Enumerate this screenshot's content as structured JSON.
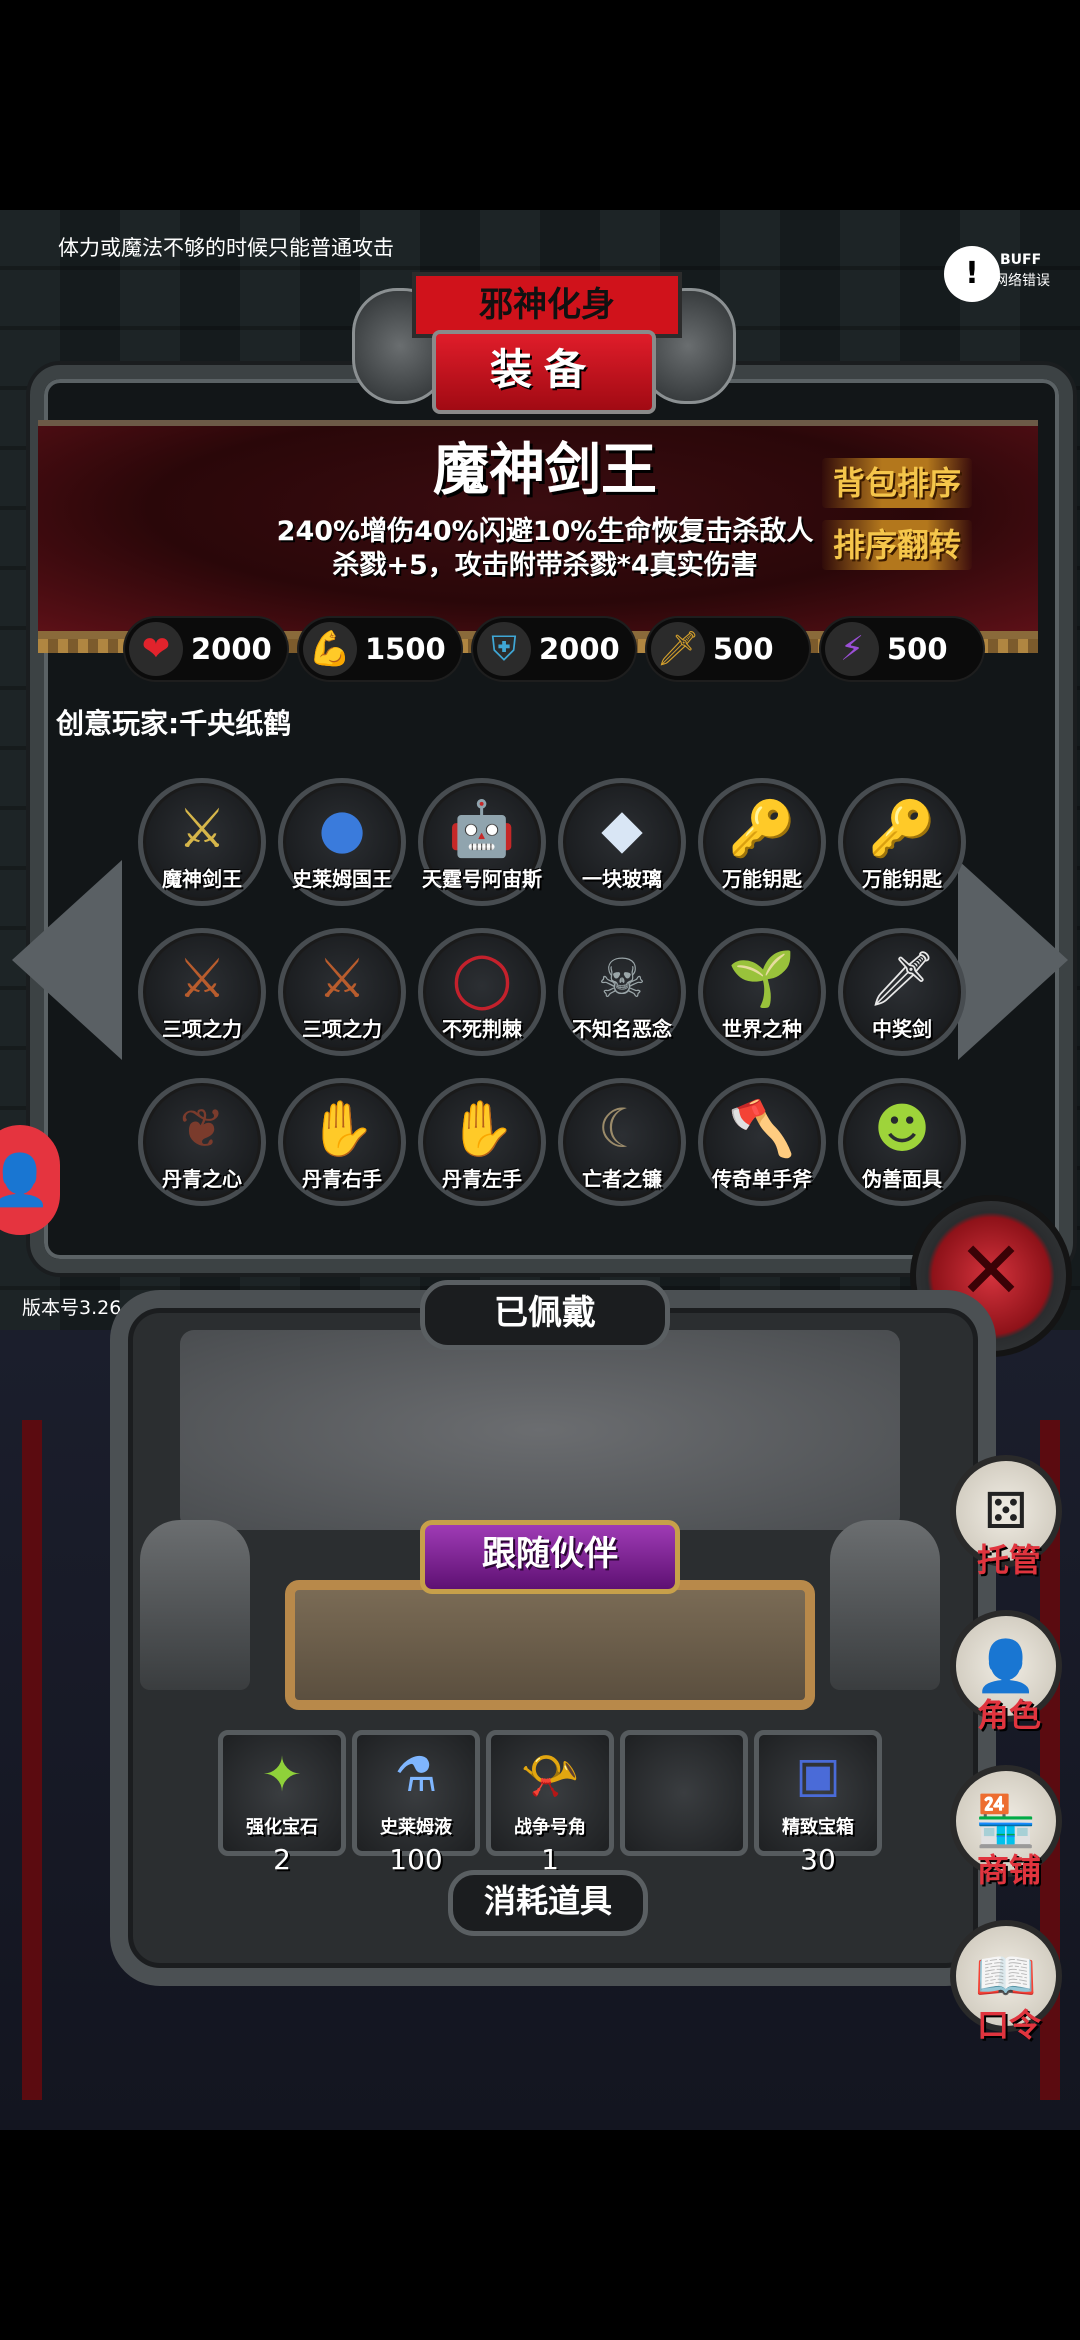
{
  "hint": "体力或魔法不够的时候只能普通攻击",
  "buff": {
    "icon": "buff-error-icon",
    "label": "BUFF",
    "status": "网络错误"
  },
  "header": {
    "subtitle": "邪神化身",
    "title": "装备"
  },
  "item": {
    "name": "魔神剑王",
    "desc_line1": "240%增伤40%闪避10%生命恢复击杀敌人",
    "desc_line2": "杀戮+5，攻击附带杀戮*4真实伤害"
  },
  "buttons": {
    "sort_bag": "背包排序",
    "sort_flip": "排序翻转"
  },
  "stats": [
    {
      "icon": "heart-icon",
      "glyph": "❤",
      "color": "#e2232c",
      "value": "2000"
    },
    {
      "icon": "strength-icon",
      "glyph": "💪",
      "color": "#e6c23a",
      "value": "1500"
    },
    {
      "icon": "shield-icon",
      "glyph": "⛨",
      "color": "#3fa7d6",
      "value": "2000"
    },
    {
      "icon": "sword-icon",
      "glyph": "🗡",
      "color": "#d4a02c",
      "value": "500"
    },
    {
      "icon": "lightning-icon",
      "glyph": "⚡",
      "color": "#9b4fd6",
      "value": "500"
    }
  ],
  "creator": "创意玩家:千央纸鹤",
  "inventory": [
    {
      "label": "魔神剑王",
      "glyph": "⚔",
      "color": "#d6b64a"
    },
    {
      "label": "史莱姆国王",
      "glyph": "●",
      "color": "#3a7bdc"
    },
    {
      "label": "天霆号阿宙斯",
      "glyph": "🤖",
      "color": "#cfcfcf"
    },
    {
      "label": "一块玻璃",
      "glyph": "◆",
      "color": "#d9e6f5"
    },
    {
      "label": "万能钥匙",
      "glyph": "🔑",
      "color": "#c9a13f"
    },
    {
      "label": "万能钥匙",
      "glyph": "🔑",
      "color": "#c9a13f"
    },
    {
      "label": "三项之力",
      "glyph": "⚔",
      "color": "#b85c2d"
    },
    {
      "label": "三项之力",
      "glyph": "⚔",
      "color": "#b85c2d"
    },
    {
      "label": "不死荆棘",
      "glyph": "◯",
      "color": "#c4212c"
    },
    {
      "label": "不知名恶念",
      "glyph": "☠",
      "color": "#9aa5a8"
    },
    {
      "label": "世界之种",
      "glyph": "🌱",
      "color": "#6cc24a"
    },
    {
      "label": "中奖剑",
      "glyph": "🗡",
      "color": "#e8e8e8"
    },
    {
      "label": "丹青之心",
      "glyph": "❦",
      "color": "#7a3b2c"
    },
    {
      "label": "丹青右手",
      "glyph": "✋",
      "color": "#e6e6e6"
    },
    {
      "label": "丹青左手",
      "glyph": "✋",
      "color": "#e6e6e6"
    },
    {
      "label": "亡者之镰",
      "glyph": "☾",
      "color": "#9b8b6a"
    },
    {
      "label": "传奇单手斧",
      "glyph": "🪓",
      "color": "#7a5ed6"
    },
    {
      "label": "伪善面具",
      "glyph": "☻",
      "color": "#9ed43a"
    }
  ],
  "version": "版本号3.26",
  "equipped_label": "已佩戴",
  "follow_label": "跟随伙伴",
  "consumables_label": "消耗道具",
  "consumables": [
    {
      "label": "强化宝石",
      "glyph": "✦",
      "color": "#8fd13a",
      "count": "2"
    },
    {
      "label": "史莱姆液",
      "glyph": "⚗",
      "color": "#7fb6ff",
      "count": "100"
    },
    {
      "label": "战争号角",
      "glyph": "📯",
      "color": "#c46adf",
      "count": "1"
    },
    {
      "label": "",
      "glyph": "",
      "color": "#888",
      "count": ""
    },
    {
      "label": "精致宝箱",
      "glyph": "▣",
      "color": "#4a6bd8",
      "count": "30"
    }
  ],
  "side_menu": [
    {
      "label": "托管",
      "glyph": "⚄",
      "icon": "dice-icon"
    },
    {
      "label": "角色",
      "glyph": "👤",
      "icon": "character-icon"
    },
    {
      "label": "商铺",
      "glyph": "🏪",
      "icon": "shop-icon"
    },
    {
      "label": "口令",
      "glyph": "📖",
      "icon": "password-book-icon"
    }
  ]
}
